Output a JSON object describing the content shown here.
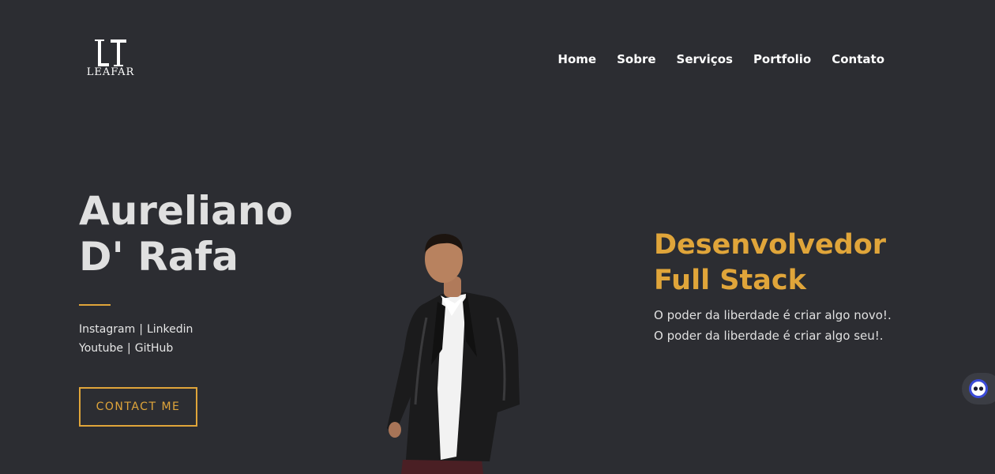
{
  "brand": {
    "monogram": "LT",
    "wordmark": "LEAFAR"
  },
  "nav": {
    "items": [
      "Home",
      "Sobre",
      "Serviços",
      "Portfolio",
      "Contato"
    ]
  },
  "hero": {
    "name_line1": "Aureliano",
    "name_line2": "D' Rafa",
    "social_row1": [
      "Instagram",
      "Linkedin"
    ],
    "social_row2": [
      "Youtube",
      "GitHub"
    ],
    "separator": "|",
    "cta_label": "CONTACT ME"
  },
  "role": {
    "line1": "Desenvolvedor",
    "line2": "Full Stack"
  },
  "tagline": {
    "line1": "O poder da liberdade é criar algo novo!.",
    "line2": "O poder da liberdade é criar algo seu!."
  },
  "colors": {
    "background": "#2c2d32",
    "accent": "#e0a53a",
    "text": "#e0e0e0"
  },
  "icons": {
    "chat": "chat-bot-icon"
  }
}
